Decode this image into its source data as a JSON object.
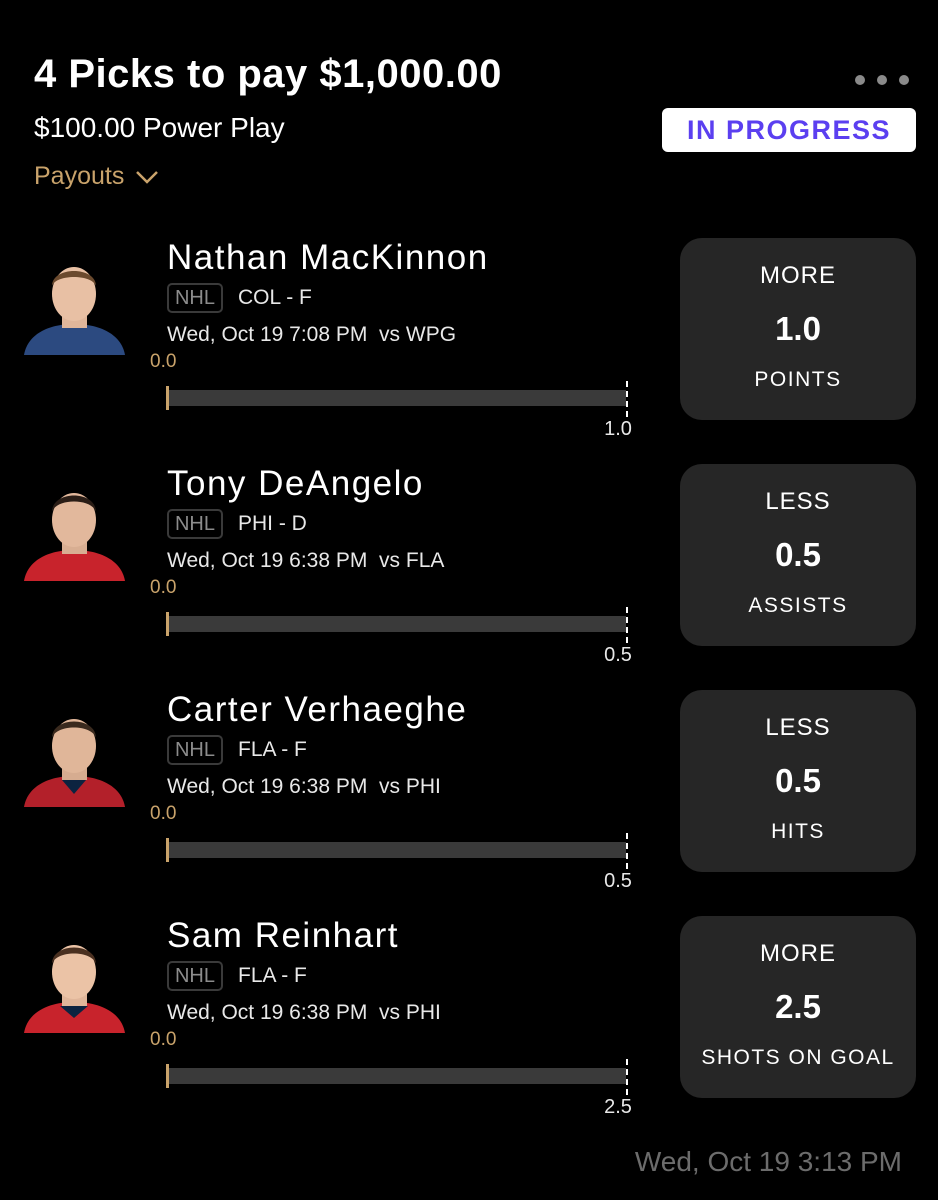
{
  "header": {
    "title": "4 Picks to pay $1,000.00",
    "subtitle": "$100.00 Power Play",
    "status": "IN PROGRESS",
    "payouts_label": "Payouts",
    "more_icon": "more-horizontal-icon"
  },
  "colors": {
    "accent_gold": "#c9a36b",
    "status_text": "#5b3ff0",
    "card_bg": "#262626",
    "track": "#3a3a3a"
  },
  "picks": [
    {
      "name": "Nathan MacKinnon",
      "league": "NHL",
      "team_pos": "COL - F",
      "game": "Wed, Oct 19 7:08 PM  vs WPG",
      "current": "0.0",
      "target": "1.0",
      "progress_fraction": 0,
      "direction": "MORE",
      "line": "1.0",
      "stat": "POINTS",
      "jersey_color": "#2c4a80"
    },
    {
      "name": "Tony DeAngelo",
      "league": "NHL",
      "team_pos": "PHI - D",
      "game": "Wed, Oct 19 6:38 PM  vs FLA",
      "current": "0.0",
      "target": "0.5",
      "progress_fraction": 0,
      "direction": "LESS",
      "line": "0.5",
      "stat": "ASSISTS",
      "jersey_color": "#c8232c"
    },
    {
      "name": "Carter Verhaeghe",
      "league": "NHL",
      "team_pos": "FLA - F",
      "game": "Wed, Oct 19 6:38 PM  vs PHI",
      "current": "0.0",
      "target": "0.5",
      "progress_fraction": 0,
      "direction": "LESS",
      "line": "0.5",
      "stat": "HITS",
      "jersey_color": "#b3202a"
    },
    {
      "name": "Sam Reinhart",
      "league": "NHL",
      "team_pos": "FLA - F",
      "game": "Wed, Oct 19 6:38 PM  vs PHI",
      "current": "0.0",
      "target": "2.5",
      "progress_fraction": 0,
      "direction": "MORE",
      "line": "2.5",
      "stat": "SHOTS ON GOAL",
      "jersey_color": "#c8232c"
    }
  ],
  "footer": {
    "timestamp": "Wed, Oct 19 3:13 PM"
  }
}
